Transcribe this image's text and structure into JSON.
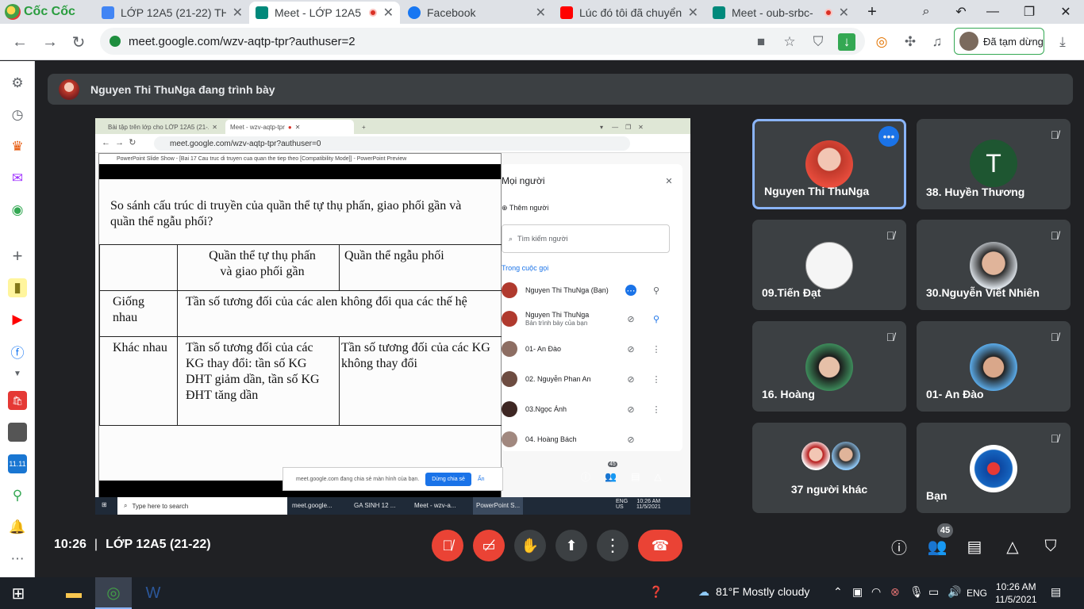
{
  "browser": {
    "logo": "Cốc Cốc",
    "tabs": [
      {
        "title": "LỚP 12A5 (21-22) TH",
        "color": "#4285f4"
      },
      {
        "title": "Meet - LỚP 12A5",
        "color": "#00897b"
      },
      {
        "title": "Facebook",
        "color": "#1877f2"
      },
      {
        "title": "Lúc đó tôi đã chuyển",
        "color": "#ff0000"
      },
      {
        "title": "Meet - oub-srbc-",
        "color": "#00897b"
      }
    ],
    "url": "meet.google.com/wzv-aqtp-tpr?authuser=2",
    "profile_label": "Đã tạm dừng"
  },
  "banner": {
    "text": "Nguyen Thi ThuNga đang trình bày"
  },
  "shared_screen": {
    "inner_tabs": [
      "Bài tập trên lớp cho LỚP 12A5 (21-...",
      "Meet - wzv-aqtp-tpr"
    ],
    "inner_url": "meet.google.com/wzv-aqtp-tpr?authuser=0",
    "ppt_title": "PowerPoint Slide Show - [Bai 17 Cau truc di truyen cua quan the tiep theo [Compatibility Mode]] - PowerPoint Preview",
    "slide": {
      "question": "So sánh cấu trúc di truyền của quần thể tự thụ phấn, giao phối gần và quần thể ngẫu phối?",
      "header": [
        "",
        "Quần thể tự thụ phấn\nvà giao phối gần",
        "Quần thể ngẫu phối"
      ],
      "row1_label": "Giống nhau",
      "row1_text": "Tần số tương đối của các alen không đổi qua các thế hệ",
      "row2_label": "Khác nhau",
      "row2_col1": "Tần số tương đối của các KG thay đổi: tần số KG DHT giảm dần, tần số KG ĐHT tăng dần",
      "row2_col2": "Tần số tương đối của các KG không thay đổi"
    },
    "share_notice": "meet.google.com đang chia sẻ màn hình của bạn.",
    "share_stop": "Dừng chia sẻ",
    "share_hide": "Ẩn",
    "people_panel": {
      "title": "Mọi người",
      "add": "Thêm người",
      "search_placeholder": "Tìm kiếm người",
      "section": "Trong cuộc gọi",
      "rows": [
        {
          "name": "Nguyen Thi ThuNga (Bạn)",
          "sub": ""
        },
        {
          "name": "Nguyen Thi ThuNga",
          "sub": "Bản trình bày của bạn"
        },
        {
          "name": "01- An Đào",
          "sub": ""
        },
        {
          "name": "02. Nguyễn Phan An",
          "sub": ""
        },
        {
          "name": "03.Ngọc Ánh",
          "sub": ""
        },
        {
          "name": "04. Hoàng Bách",
          "sub": ""
        }
      ],
      "count": "45"
    },
    "taskbar": {
      "search": "Type here to search",
      "apps": [
        "meet.google...",
        "GA SINH 12 ...",
        "Meet - wzv-a...",
        "PowerPoint S..."
      ],
      "lang": "ENG\nUS",
      "time": "10:26 AM",
      "date": "11/5/2021"
    }
  },
  "tiles": [
    {
      "name": "Nguyen Thi ThuNga",
      "active": true
    },
    {
      "name": "38. Huyền Thương",
      "initial": "T"
    },
    {
      "name": "09.Tiến Đạt"
    },
    {
      "name": "30.Nguyễn Viết Nhiên"
    },
    {
      "name": "16. Hoàng"
    },
    {
      "name": "01- An Đào"
    },
    {
      "name": "37 người khác"
    },
    {
      "name": "Bạn"
    }
  ],
  "controls": {
    "time": "10:26",
    "separator": "|",
    "meeting": "LỚP 12A5 (21-22)",
    "participants": "45"
  },
  "taskbar": {
    "weather": "81°F  Mostly cloudy",
    "lang": "ENG",
    "time": "10:26 AM",
    "date": "11/5/2021"
  }
}
